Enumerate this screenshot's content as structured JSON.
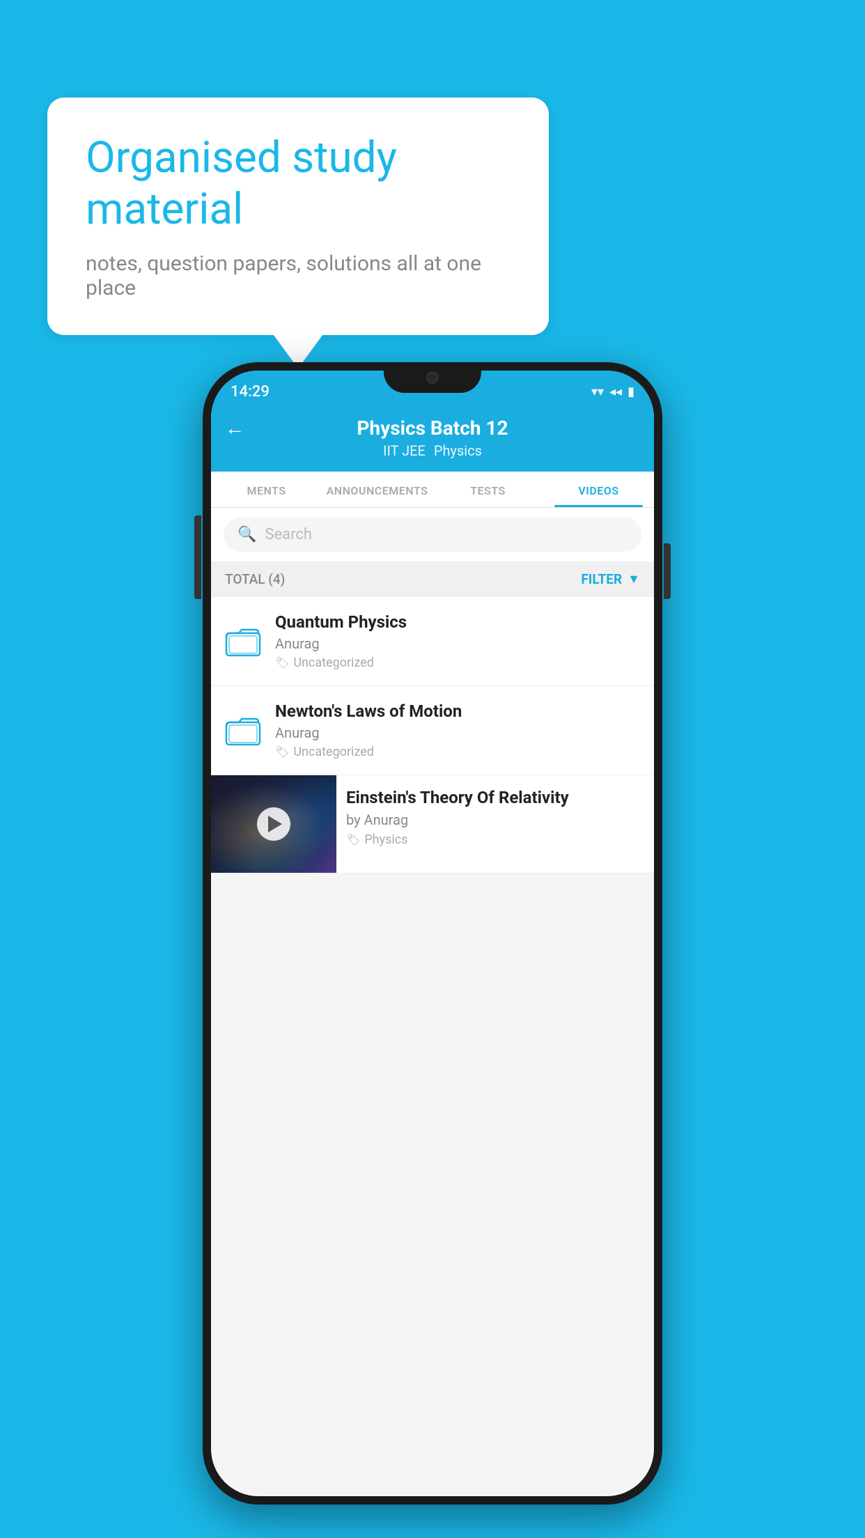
{
  "background_color": "#1ab8e8",
  "speech_bubble": {
    "title": "Organised study material",
    "subtitle": "notes, question papers, solutions all at one place"
  },
  "status_bar": {
    "time": "14:29",
    "wifi": "▼",
    "signal": "◂◂",
    "battery": "▮"
  },
  "header": {
    "back_label": "←",
    "title": "Physics Batch 12",
    "subtitle_left": "IIT JEE",
    "subtitle_right": "Physics"
  },
  "tabs": [
    {
      "label": "MENTS",
      "active": false
    },
    {
      "label": "ANNOUNCEMENTS",
      "active": false
    },
    {
      "label": "TESTS",
      "active": false
    },
    {
      "label": "VIDEOS",
      "active": true
    }
  ],
  "search": {
    "placeholder": "Search"
  },
  "filter": {
    "total_label": "TOTAL (4)",
    "filter_label": "FILTER"
  },
  "list_items": [
    {
      "title": "Quantum Physics",
      "author": "Anurag",
      "tag": "Uncategorized",
      "type": "folder"
    },
    {
      "title": "Newton's Laws of Motion",
      "author": "Anurag",
      "tag": "Uncategorized",
      "type": "folder"
    }
  ],
  "video_item": {
    "title": "Einstein's Theory Of Relativity",
    "author": "by Anurag",
    "tag": "Physics",
    "type": "video"
  }
}
